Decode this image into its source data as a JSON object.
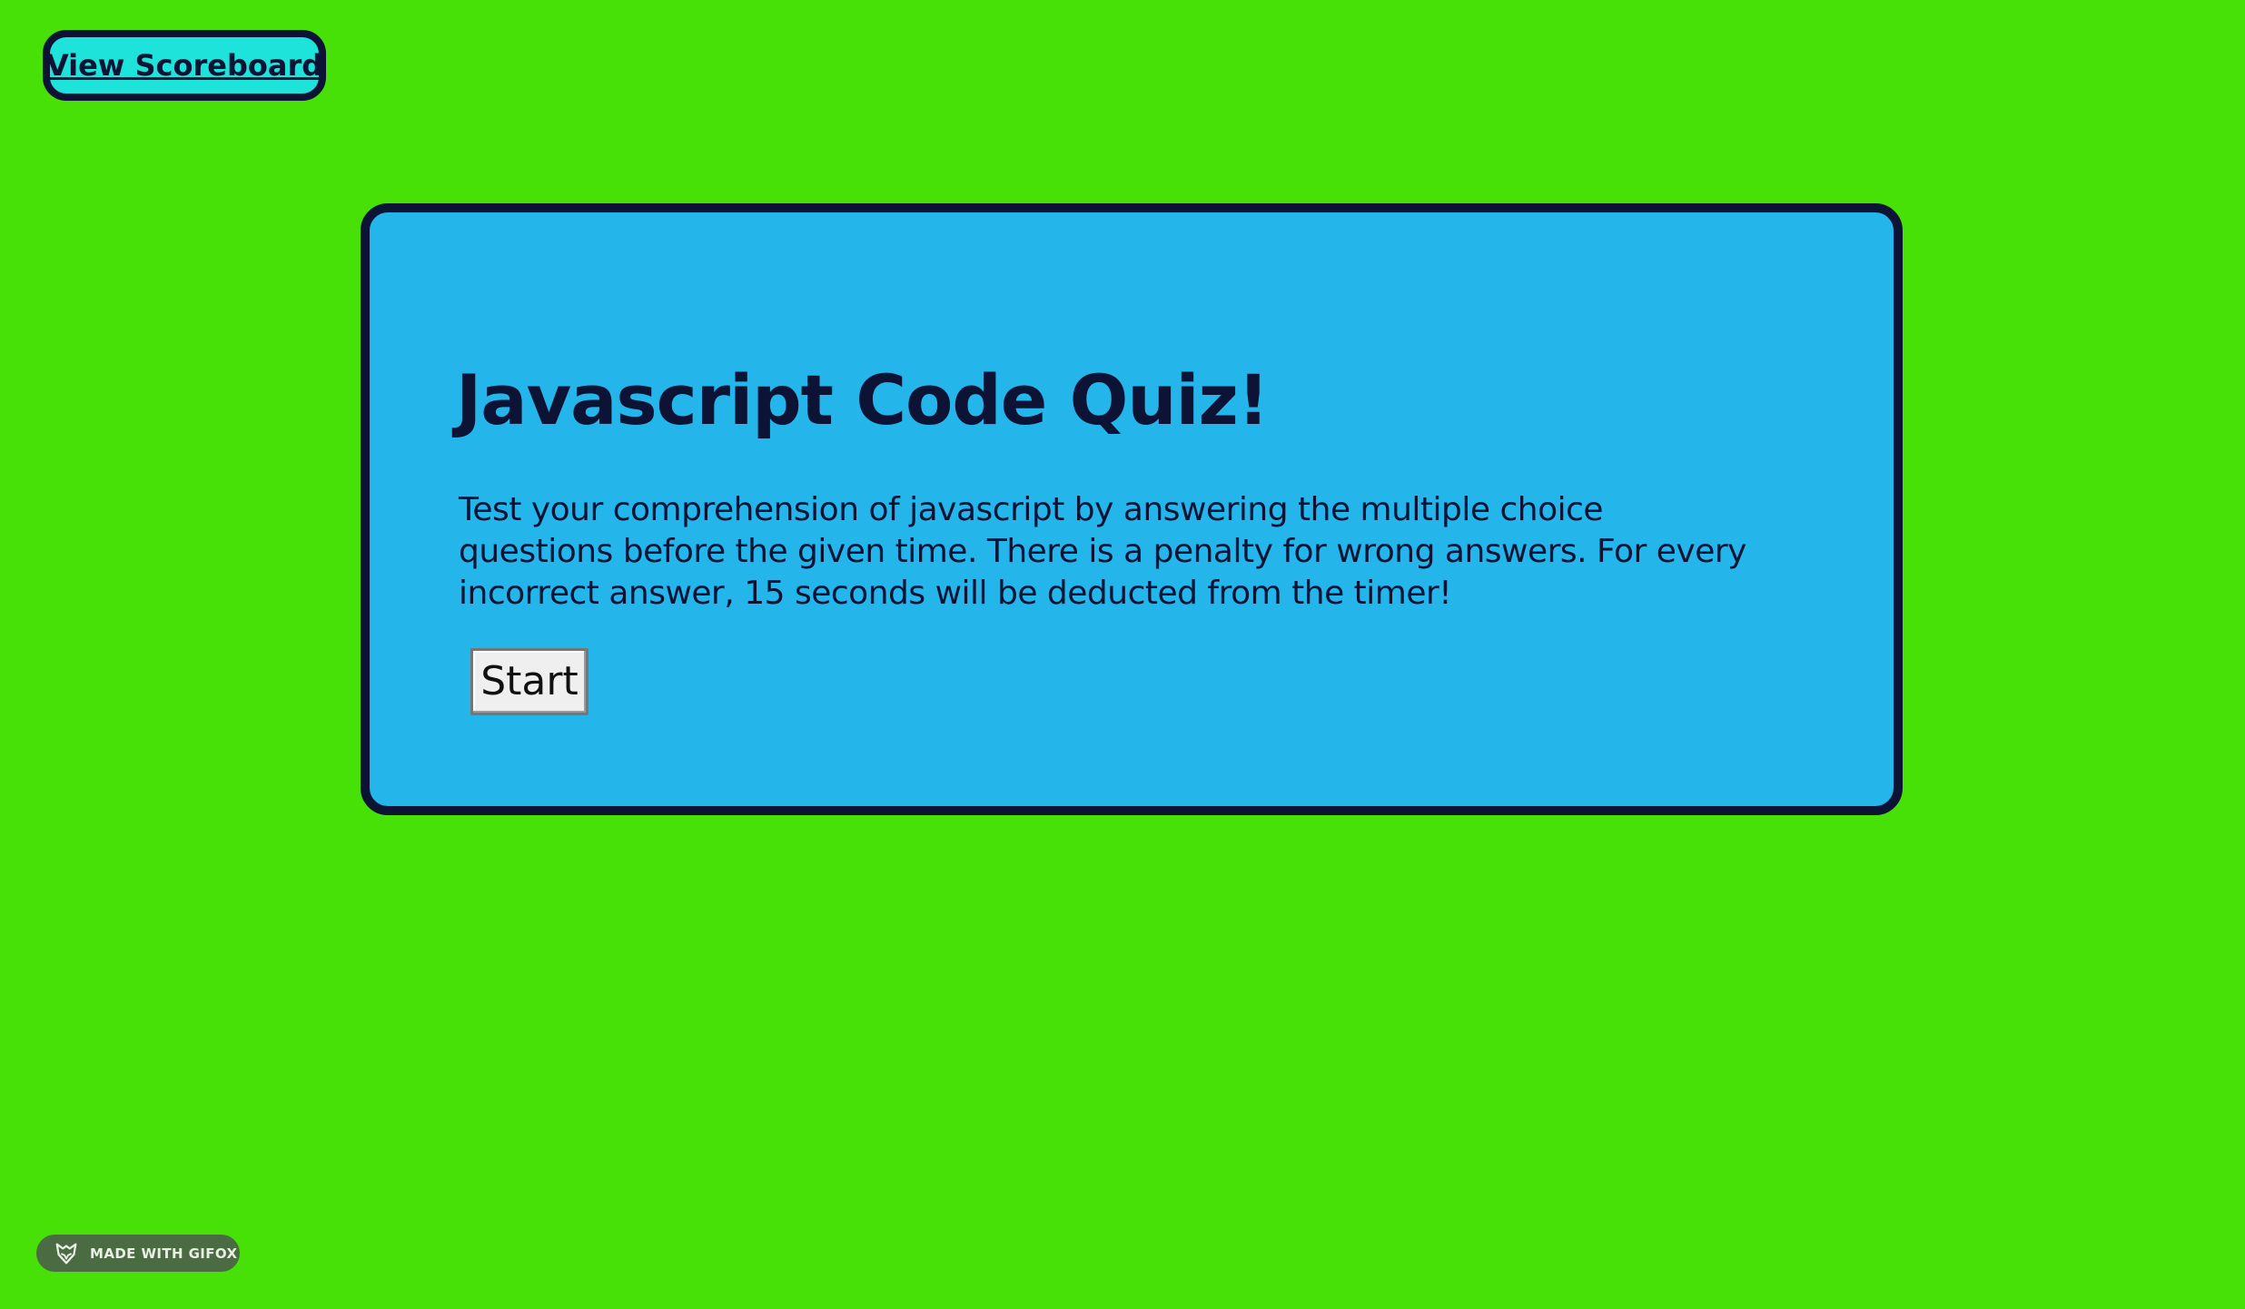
{
  "header": {
    "scoreboard_label": "View Scoreboard"
  },
  "quiz": {
    "title": "Javascript Code Quiz!",
    "description": "Test your comprehension of javascript by answering the multiple choice questions before the given time. There is a penalty for wrong answers. For every incorrect answer, 15 seconds will be deducted from the timer!",
    "start_label": "Start"
  },
  "watermark": {
    "text": "MADE WITH GIFOX",
    "icon": "fox-icon"
  },
  "colors": {
    "background": "#47e007",
    "card": "#24b6ea",
    "scoreboard": "#1de3db",
    "text": "#0c1334"
  }
}
